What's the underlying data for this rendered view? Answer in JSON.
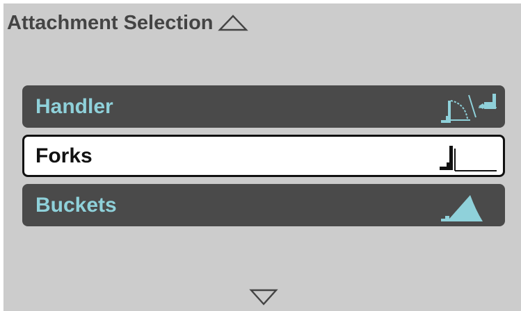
{
  "header": {
    "title": "Attachment Selection",
    "scroll_up_icon": "triangle-up-outline-icon"
  },
  "menu": {
    "items": [
      {
        "label": "Handler",
        "icon": "handler-attachment-icon",
        "selected": false
      },
      {
        "label": "Forks",
        "icon": "forks-attachment-icon",
        "selected": true
      },
      {
        "label": "Buckets",
        "icon": "bucket-attachment-icon",
        "selected": false
      }
    ]
  },
  "footer": {
    "scroll_down_icon": "triangle-down-outline-icon"
  },
  "colors": {
    "screen_background": "#cccccc",
    "item_background": "#4a4a4a",
    "item_label": "#8fd1da",
    "selected_background": "#ffffff",
    "selected_text": "#111111",
    "title_text": "#444444"
  }
}
